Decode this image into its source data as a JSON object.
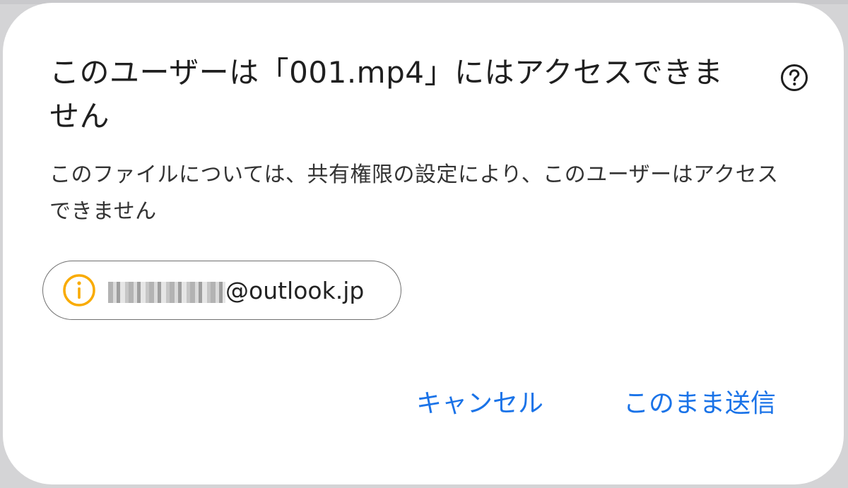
{
  "dialog": {
    "title": "このユーザーは「001.mp4」にはアクセスできません",
    "description": "このファイルについては、共有権限の設定により、このユーザーはアクセスできません",
    "help_icon": "help-circle-icon",
    "recipient": {
      "icon": "info-icon",
      "icon_color": "#f9ab00",
      "email_domain": "@outlook.jp"
    },
    "buttons": {
      "cancel_label": "キャンセル",
      "send_label": "このまま送信",
      "color": "#1a73e8"
    }
  }
}
